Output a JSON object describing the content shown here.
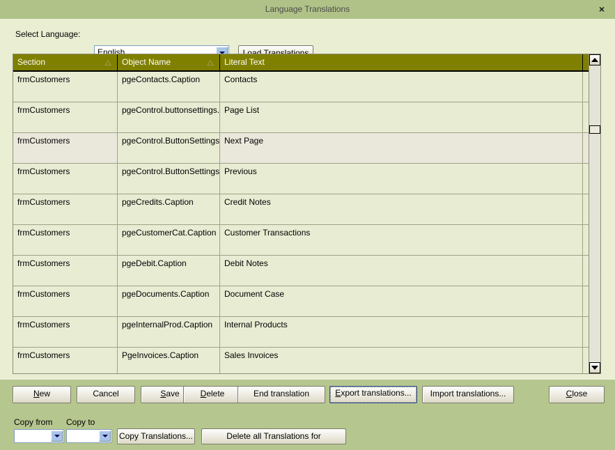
{
  "window": {
    "title": "Language Translations",
    "close_icon": "close-icon",
    "close_glyph": "×"
  },
  "toolbar": {
    "language_label": "Select Language:",
    "language_value": "English",
    "language_dropdown_icon": "chevron-down-icon",
    "load_button": "Load Translations"
  },
  "grid": {
    "columns": [
      {
        "label": "Section",
        "sort_indicator": "sort-ascending-icon"
      },
      {
        "label": "Object Name",
        "sort_indicator": "sort-ascending-icon"
      },
      {
        "label": "Literal Text",
        "sort_indicator": ""
      },
      {
        "label": "",
        "sort_indicator": ""
      }
    ],
    "rows": [
      {
        "section": "frmCustomers",
        "object_name": "pgeContacts.Caption",
        "literal_text": "Contacts",
        "highlighted": false
      },
      {
        "section": "frmCustomers",
        "object_name": "pgeControl.buttonsettings.Pag",
        "literal_text": "Page List",
        "highlighted": false
      },
      {
        "section": "frmCustomers",
        "object_name": "pgeControl.ButtonSettings.Sc",
        "literal_text": "Next Page",
        "highlighted": true
      },
      {
        "section": "frmCustomers",
        "object_name": "pgeControl.ButtonSettings.Sc",
        "literal_text": "Previous",
        "highlighted": false
      },
      {
        "section": "frmCustomers",
        "object_name": "pgeCredits.Caption",
        "literal_text": "Credit Notes",
        "highlighted": false
      },
      {
        "section": "frmCustomers",
        "object_name": "pgeCustomerCat.Caption",
        "literal_text": "Customer Transactions",
        "highlighted": false
      },
      {
        "section": "frmCustomers",
        "object_name": "pgeDebit.Caption",
        "literal_text": "Debit Notes",
        "highlighted": false
      },
      {
        "section": "frmCustomers",
        "object_name": "pgeDocuments.Caption",
        "literal_text": "Document Case",
        "highlighted": false
      },
      {
        "section": "frmCustomers",
        "object_name": "pgeInternalProd.Caption",
        "literal_text": "Internal Products",
        "highlighted": false
      },
      {
        "section": "frmCustomers",
        "object_name": "PgeInvoices.Caption",
        "literal_text": "Sales Invoices",
        "highlighted": false
      }
    ]
  },
  "scrollbar": {
    "up_icon": "arrow-up-icon",
    "down_icon": "arrow-down-icon"
  },
  "buttons": {
    "new": {
      "prefix": "",
      "accel": "N",
      "suffix": "ew"
    },
    "cancel": {
      "prefix": "Cancel",
      "accel": "",
      "suffix": ""
    },
    "save": {
      "prefix": "",
      "accel": "S",
      "suffix": "ave"
    },
    "delete": {
      "prefix": "",
      "accel": "D",
      "suffix": "elete"
    },
    "end_translation": {
      "prefix": "End translation",
      "accel": "",
      "suffix": ""
    },
    "export": {
      "prefix": "",
      "accel": "E",
      "suffix": "xport translations..."
    },
    "import": {
      "prefix": "Import translations...",
      "accel": "",
      "suffix": ""
    },
    "close": {
      "prefix": "",
      "accel": "C",
      "suffix": "lose"
    }
  },
  "copy_panel": {
    "from_label": "Copy from",
    "to_label": "Copy to",
    "from_value": "",
    "to_value": "",
    "from_dropdown_icon": "chevron-down-icon",
    "to_dropdown_icon": "chevron-down-icon",
    "copy_button": "Copy Translations...",
    "delete_all_button": "Delete all Translations for"
  },
  "colors": {
    "titlebar": "#b0c287",
    "body": "#eaefd4",
    "panel": "#b6c68f",
    "grid_header": "#808000",
    "row": "#e8ecd3",
    "row_highlight": "#eae7db"
  }
}
